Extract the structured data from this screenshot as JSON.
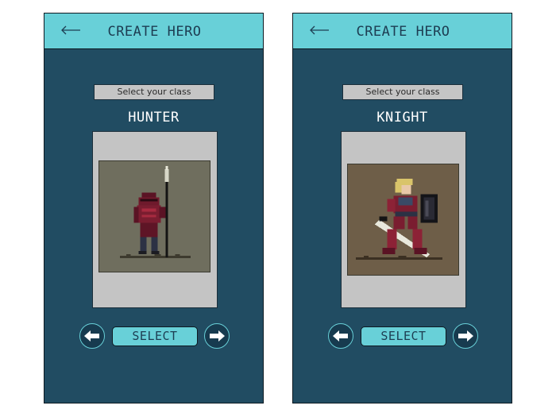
{
  "screens": [
    {
      "title": "CREATE HERO",
      "class_label": "Select your class",
      "class_name": "HUNTER",
      "select_label": "SELECT",
      "portrait": "hunter-sprite"
    },
    {
      "title": "CREATE HERO",
      "class_label": "Select your class",
      "class_name": "KNIGHT",
      "select_label": "SELECT",
      "portrait": "knight-sprite"
    }
  ],
  "colors": {
    "panel": "#214c62",
    "accent": "#68d0d8",
    "card": "#c4c4c4",
    "title_text": "#1d3d52"
  }
}
